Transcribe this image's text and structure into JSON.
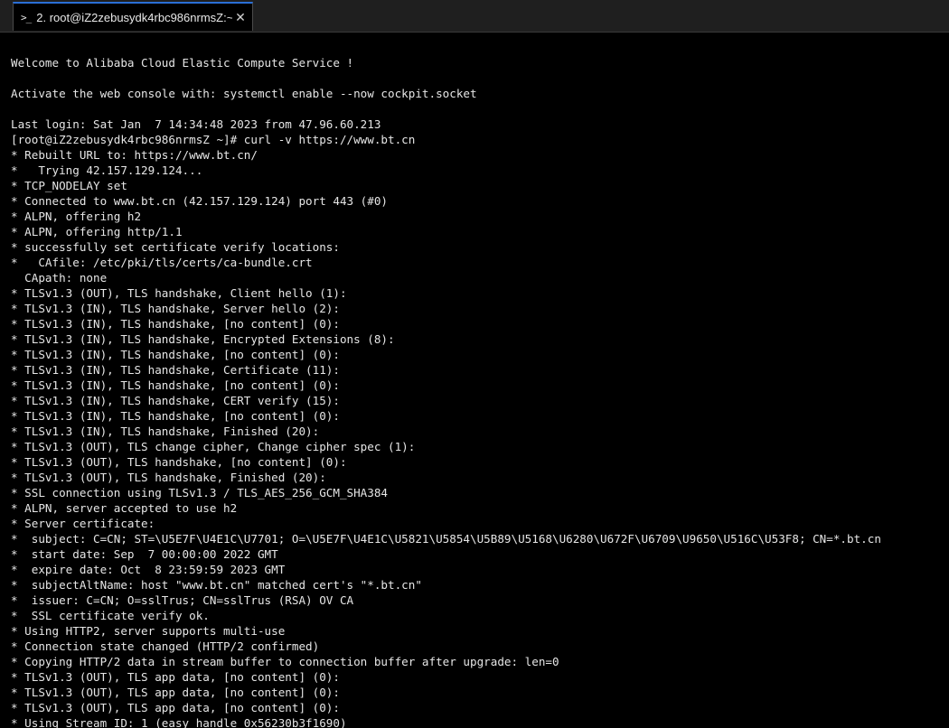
{
  "tab": {
    "icon": ">_",
    "title": "2. root@iZ2zebusydk4rbc986nrmsZ:~",
    "close_glyph": "✕"
  },
  "terminal": {
    "lines": [
      "",
      "Welcome to Alibaba Cloud Elastic Compute Service !",
      "",
      "Activate the web console with: systemctl enable --now cockpit.socket",
      "",
      "Last login: Sat Jan  7 14:34:48 2023 from 47.96.60.213",
      "[root@iZ2zebusydk4rbc986nrmsZ ~]# curl -v https://www.bt.cn",
      "* Rebuilt URL to: https://www.bt.cn/",
      "*   Trying 42.157.129.124...",
      "* TCP_NODELAY set",
      "* Connected to www.bt.cn (42.157.129.124) port 443 (#0)",
      "* ALPN, offering h2",
      "* ALPN, offering http/1.1",
      "* successfully set certificate verify locations:",
      "*   CAfile: /etc/pki/tls/certs/ca-bundle.crt",
      "  CApath: none",
      "* TLSv1.3 (OUT), TLS handshake, Client hello (1):",
      "* TLSv1.3 (IN), TLS handshake, Server hello (2):",
      "* TLSv1.3 (IN), TLS handshake, [no content] (0):",
      "* TLSv1.3 (IN), TLS handshake, Encrypted Extensions (8):",
      "* TLSv1.3 (IN), TLS handshake, [no content] (0):",
      "* TLSv1.3 (IN), TLS handshake, Certificate (11):",
      "* TLSv1.3 (IN), TLS handshake, [no content] (0):",
      "* TLSv1.3 (IN), TLS handshake, CERT verify (15):",
      "* TLSv1.3 (IN), TLS handshake, [no content] (0):",
      "* TLSv1.3 (IN), TLS handshake, Finished (20):",
      "* TLSv1.3 (OUT), TLS change cipher, Change cipher spec (1):",
      "* TLSv1.3 (OUT), TLS handshake, [no content] (0):",
      "* TLSv1.3 (OUT), TLS handshake, Finished (20):",
      "* SSL connection using TLSv1.3 / TLS_AES_256_GCM_SHA384",
      "* ALPN, server accepted to use h2",
      "* Server certificate:",
      "*  subject: C=CN; ST=\\U5E7F\\U4E1C\\U7701; O=\\U5E7F\\U4E1C\\U5821\\U5854\\U5B89\\U5168\\U6280\\U672F\\U6709\\U9650\\U516C\\U53F8; CN=*.bt.cn",
      "*  start date: Sep  7 00:00:00 2022 GMT",
      "*  expire date: Oct  8 23:59:59 2023 GMT",
      "*  subjectAltName: host \"www.bt.cn\" matched cert's \"*.bt.cn\"",
      "*  issuer: C=CN; O=sslTrus; CN=sslTrus (RSA) OV CA",
      "*  SSL certificate verify ok.",
      "* Using HTTP2, server supports multi-use",
      "* Connection state changed (HTTP/2 confirmed)",
      "* Copying HTTP/2 data in stream buffer to connection buffer after upgrade: len=0",
      "* TLSv1.3 (OUT), TLS app data, [no content] (0):",
      "* TLSv1.3 (OUT), TLS app data, [no content] (0):",
      "* TLSv1.3 (OUT), TLS app data, [no content] (0):",
      "* Using Stream ID: 1 (easy handle 0x56230b3f1690)"
    ]
  }
}
